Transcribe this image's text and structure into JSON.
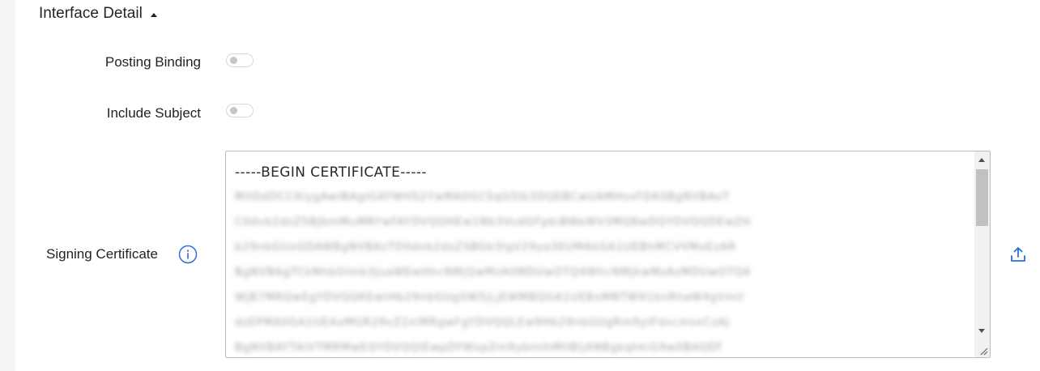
{
  "section": {
    "title": "Interface Detail"
  },
  "fields": {
    "posting_binding": {
      "label": "Posting Binding",
      "enabled": false
    },
    "include_subject": {
      "label": "Include Subject",
      "enabled": false
    },
    "signing_certificate": {
      "label": "Signing Certificate",
      "first_line": "-----BEGIN CERTIFICATE-----",
      "blurred_lines": [
        "MIIDdDCCAlygAwIBAgIGAYWHS2YwMA0GCSqGSIb3DQEBCwUAMHsxFDASBgNVBAoT",
        "C0dvb2dsZSBJbmMuMRYwFAYDVQQHEw1Nb3VudGFpbiBWaWV3MQ8wDQYDVQQDEwZH",
        "b29nbGUxGDAWBgNVBAsTD0dvb2dsZSBGb3IgV29ya3EUMAkGA1UEBhMCVVMxEzAR",
        "BgNVBAgTCkNhbGlmb3JuaWEwHhcNMjQwMzA0MDUwOTQ4WhcNMjkwMzAzMDUwOTQ4",
        "WjB7MRQwEgYDVQQKEwtHb29nbGUgSW5jLjEWMBQGA1UEBxMNTW91bnRhaW4gVmll",
        "dzEPMA0GA1UEAxMGR29vZ2xlMRgwFgYDVQQLEw9Hb29nbGUgRm9yIFdvcmsxCzAJ",
        "BgNVBAYTAlVTMRMwEQYDVQQIEwpDYWxpZm9ybmlhMIIBIjANBgkqhkiG9w0BAQEF"
      ]
    }
  },
  "icons": {
    "collapse": "caret-up-icon",
    "info": "info-icon",
    "upload": "upload-icon"
  },
  "colors": {
    "accent": "#2f6fd1",
    "toggle_knob": "#c4c6c9"
  }
}
